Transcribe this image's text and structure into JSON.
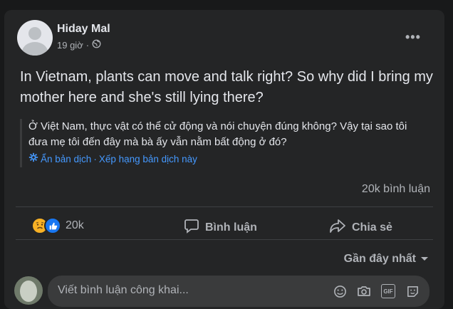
{
  "post": {
    "author": "Hiday Mal",
    "time": "19 giờ",
    "separator": "·",
    "text": "In Vietnam, plants can move and talk right? So why did I bring my mother here and she's still lying there?",
    "translation": "Ở Việt Nam, thực vật có thể cử động và nói chuyện đúng không? Vậy tại sao tôi đưa mẹ tôi đến đây mà bà ấy vẫn nằm bất động ở đó?",
    "hide_translation": "Ẩn bản dịch",
    "link_separator": "·",
    "rate_translation": "Xếp hạng bản dịch này"
  },
  "stats": {
    "comments": "20k bình luận",
    "reaction_count": "20k",
    "reactions": [
      "sad",
      "like"
    ]
  },
  "actions": {
    "comment_label": "Bình luận",
    "share_label": "Chia sẻ"
  },
  "comments": {
    "sort_label": "Gần đây nhất",
    "placeholder": "Viết bình luận công khai..."
  },
  "colors": {
    "background": "#18191a",
    "card": "#242526",
    "link": "#4599ff",
    "like": "#1877f2",
    "sad": "#f7b125"
  }
}
